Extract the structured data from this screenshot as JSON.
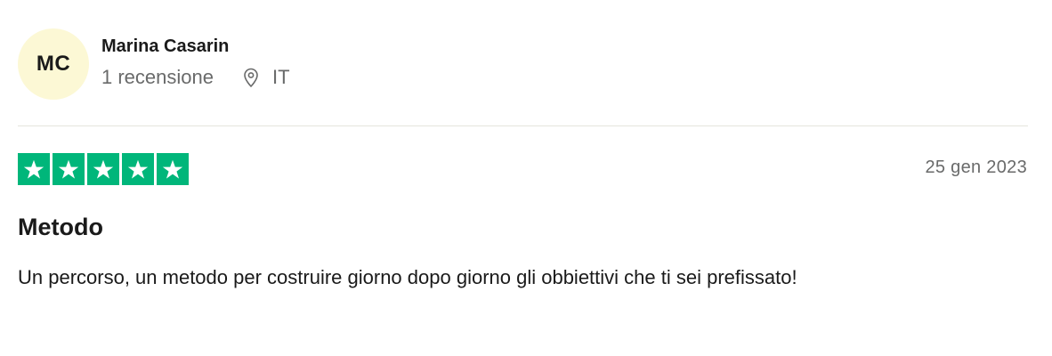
{
  "reviewer": {
    "initials": "MC",
    "name": "Marina Casarin",
    "review_count": "1 recensione",
    "country": "IT"
  },
  "review": {
    "rating": 5,
    "max_rating": 5,
    "date": "25 gen 2023",
    "title": "Metodo",
    "body": "Un percorso, un metodo per costruire giorno dopo giorno gli obbiettivi che ti sei prefissato!"
  },
  "colors": {
    "star_green": "#00b67a",
    "avatar_bg": "#fcf8d5",
    "muted_text": "#696a6a",
    "divider": "#e5e5dd"
  },
  "icons": {
    "location": "location-pin-icon",
    "star": "star-icon"
  }
}
